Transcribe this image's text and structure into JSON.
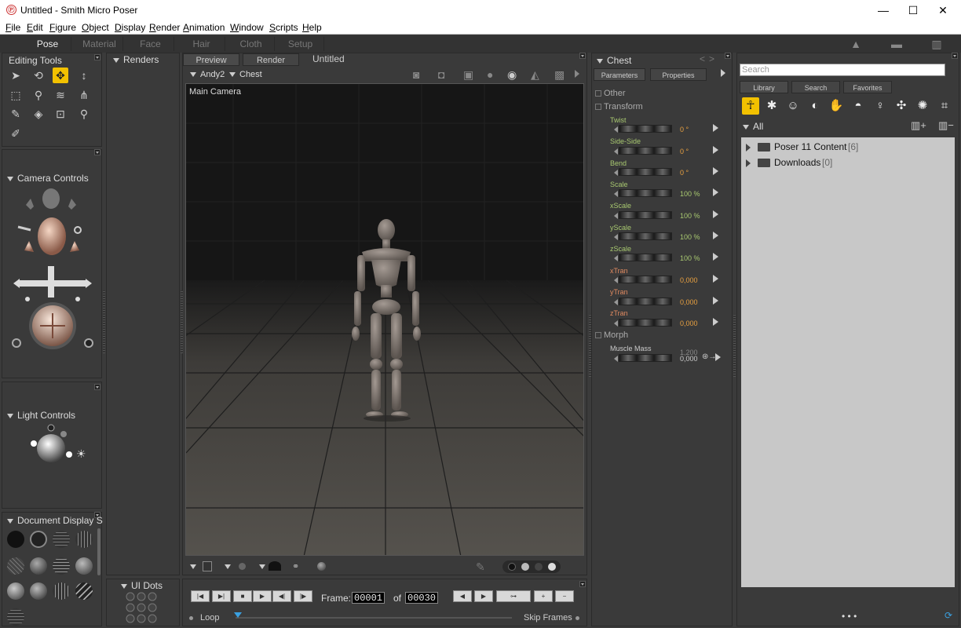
{
  "window": {
    "title": "Untitled - Smith Micro Poser",
    "minimize": "—",
    "maximize": "☐",
    "close": "✕"
  },
  "menu": [
    "File",
    "Edit",
    "Figure",
    "Object",
    "Display",
    "Render",
    "Animation",
    "Window",
    "Scripts",
    "Help"
  ],
  "rooms": [
    "Pose",
    "Material",
    "Face",
    "Hair",
    "Cloth",
    "Setup"
  ],
  "editing_tools": {
    "title": "Editing Tools"
  },
  "renders": {
    "title": "Renders"
  },
  "camera_controls": {
    "title": "Camera Controls"
  },
  "light_controls": {
    "title": "Light Controls"
  },
  "document_display": {
    "title": "Document Display S"
  },
  "ui_dots": {
    "title": "UI Dots"
  },
  "viewport": {
    "tabs": [
      "Preview",
      "Render"
    ],
    "doc_title": "Untitled",
    "figure": "Andy2",
    "actor": "Chest",
    "camera_label": "Main Camera"
  },
  "parameters": {
    "actor": "Chest",
    "tabs": [
      "Parameters",
      "Properties"
    ],
    "groups": {
      "other": "Other",
      "transform": "Transform",
      "morph": "Morph"
    },
    "transform": [
      {
        "label": "Twist",
        "value": "0 °"
      },
      {
        "label": "Side-Side",
        "value": "0 °"
      },
      {
        "label": "Bend",
        "value": "0 °"
      },
      {
        "label": "Scale",
        "value": "100 %"
      },
      {
        "label": "xScale",
        "value": "100 %"
      },
      {
        "label": "yScale",
        "value": "100 %"
      },
      {
        "label": "zScale",
        "value": "100 %"
      },
      {
        "label": "xTran",
        "value": "0,000"
      },
      {
        "label": "yTran",
        "value": "0,000"
      },
      {
        "label": "zTran",
        "value": "0,000"
      }
    ],
    "morph": [
      {
        "label": "Muscle Mass",
        "value_top": "1,200",
        "value": "0,000"
      }
    ]
  },
  "library": {
    "search_placeholder": "Search",
    "tabs": [
      "Library",
      "Search",
      "Favorites"
    ],
    "filter": "All",
    "items": [
      {
        "name": "Poser 11 Content",
        "count": "[6]"
      },
      {
        "name": "Downloads",
        "count": "[0]"
      }
    ],
    "footer_dots": "• • •"
  },
  "animation": {
    "frame_label": "Frame:",
    "frame": "00001",
    "of_label": "of",
    "total": "00030",
    "loop_label": "Loop",
    "skip_label": "Skip Frames"
  },
  "colors": {
    "accent": "#f2c100",
    "param_label": "#a8c870",
    "param_value": "#e8a040"
  }
}
